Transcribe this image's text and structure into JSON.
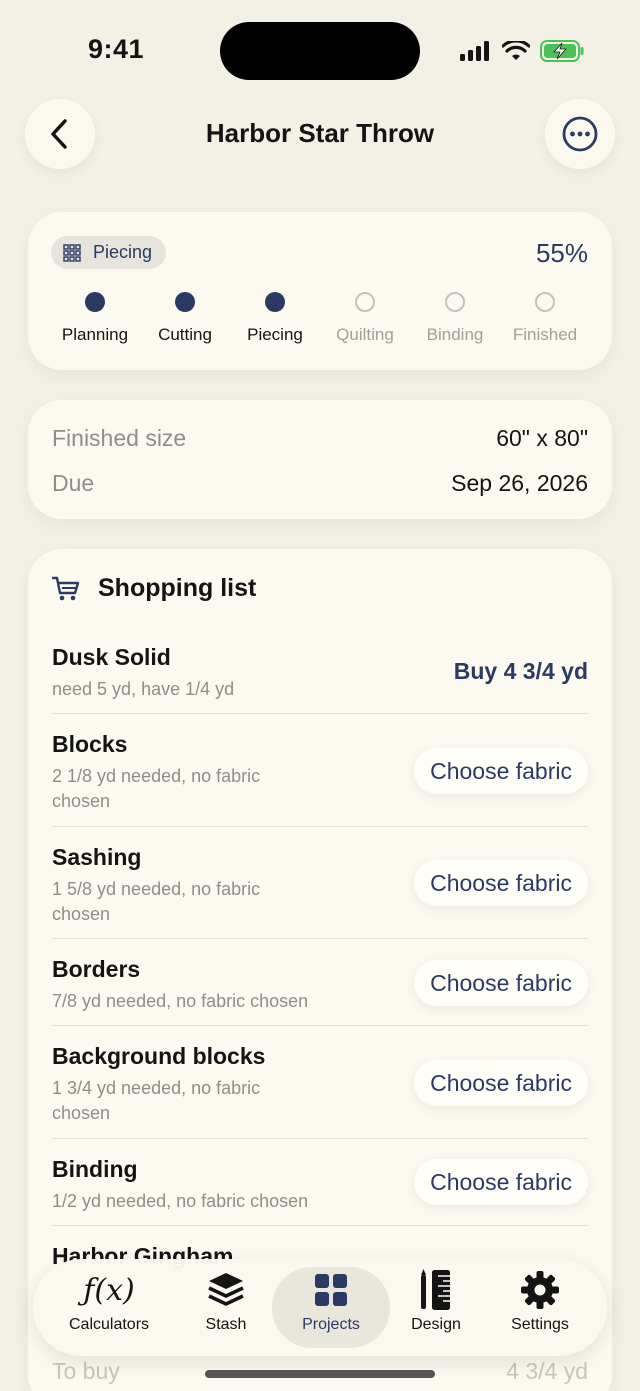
{
  "status_bar": {
    "time": "9:41"
  },
  "header": {
    "title": "Harbor Star Throw"
  },
  "progress": {
    "current_stage": "Piecing",
    "percent": "55%",
    "stages": [
      {
        "label": "Planning",
        "done": true
      },
      {
        "label": "Cutting",
        "done": true
      },
      {
        "label": "Piecing",
        "done": true
      },
      {
        "label": "Quilting",
        "done": false
      },
      {
        "label": "Binding",
        "done": false
      },
      {
        "label": "Finished",
        "done": false
      }
    ]
  },
  "details": {
    "finished_size_label": "Finished size",
    "finished_size_value": "60\" x 80\"",
    "due_label": "Due",
    "due_value": "Sep 26, 2026"
  },
  "shopping": {
    "title": "Shopping list",
    "items": [
      {
        "name": "Dusk Solid",
        "sub": "need 5 yd, have 1/4 yd",
        "action": "Buy 4 3/4 yd"
      },
      {
        "name": "Blocks",
        "sub": "2 1/8 yd needed, no fabric chosen",
        "action": "Choose fabric"
      },
      {
        "name": "Sashing",
        "sub": "1 5/8 yd needed, no fabric chosen",
        "action": "Choose fabric"
      },
      {
        "name": "Borders",
        "sub": "7/8 yd needed, no fabric chosen",
        "action": "Choose fabric"
      },
      {
        "name": "Background blocks",
        "sub": "1 3/4 yd needed, no fabric chosen",
        "action": "Choose fabric"
      },
      {
        "name": "Binding",
        "sub": "1/2 yd needed, no fabric chosen",
        "action": "Choose fabric"
      },
      {
        "name": "Harbor Gingham",
        "sub": "",
        "action": ""
      }
    ],
    "to_buy_label": "To buy",
    "to_buy_value": "4 3/4 yd"
  },
  "tabbar": {
    "tabs": [
      {
        "label": "Calculators",
        "icon": "function-icon",
        "active": false
      },
      {
        "label": "Stash",
        "icon": "stack-icon",
        "active": false
      },
      {
        "label": "Projects",
        "icon": "grid-icon",
        "active": true
      },
      {
        "label": "Design",
        "icon": "ruler-pencil-icon",
        "active": false
      },
      {
        "label": "Settings",
        "icon": "gear-icon",
        "active": false
      }
    ]
  },
  "colors": {
    "accent": "#2b3a63",
    "background": "#f3f0e6",
    "card": "#fcfaf0"
  }
}
